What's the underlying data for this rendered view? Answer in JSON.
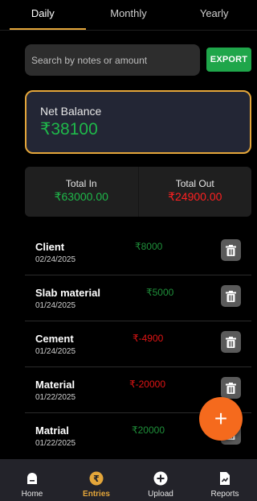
{
  "tabs": [
    {
      "label": "Daily"
    },
    {
      "label": "Monthly"
    },
    {
      "label": "Yearly"
    }
  ],
  "search": {
    "placeholder": "Search by notes or amount"
  },
  "export_label": "EXPORT",
  "net_balance": {
    "label": "Net Balance",
    "value": "₹38100"
  },
  "totals": {
    "in_label": "Total In",
    "in_value": "₹63000.00",
    "out_label": "Total Out",
    "out_value": "₹24900.00"
  },
  "entries": [
    {
      "name": "Client",
      "date": "02/24/2025",
      "amount": "₹8000",
      "type": "in"
    },
    {
      "name": "Slab material",
      "date": "01/24/2025",
      "amount": "₹5000",
      "type": "in"
    },
    {
      "name": "Cement",
      "date": "01/24/2025",
      "amount": "₹-4900",
      "type": "out"
    },
    {
      "name": "Material",
      "date": "01/22/2025",
      "amount": "₹-20000",
      "type": "out"
    },
    {
      "name": "Matrial",
      "date": "01/22/2025",
      "amount": "₹20000",
      "type": "in"
    }
  ],
  "fab_label": "+",
  "nav": [
    {
      "label": "Home",
      "icon": "home-icon"
    },
    {
      "label": "Entries",
      "icon": "rupee-icon"
    },
    {
      "label": "Upload",
      "icon": "upload-icon"
    },
    {
      "label": "Reports",
      "icon": "report-icon"
    }
  ],
  "colors": {
    "accent": "#e4a63a",
    "positive": "#1fb84a",
    "negative": "#ff2020",
    "fab": "#f56a1d",
    "export": "#1fa64a"
  }
}
